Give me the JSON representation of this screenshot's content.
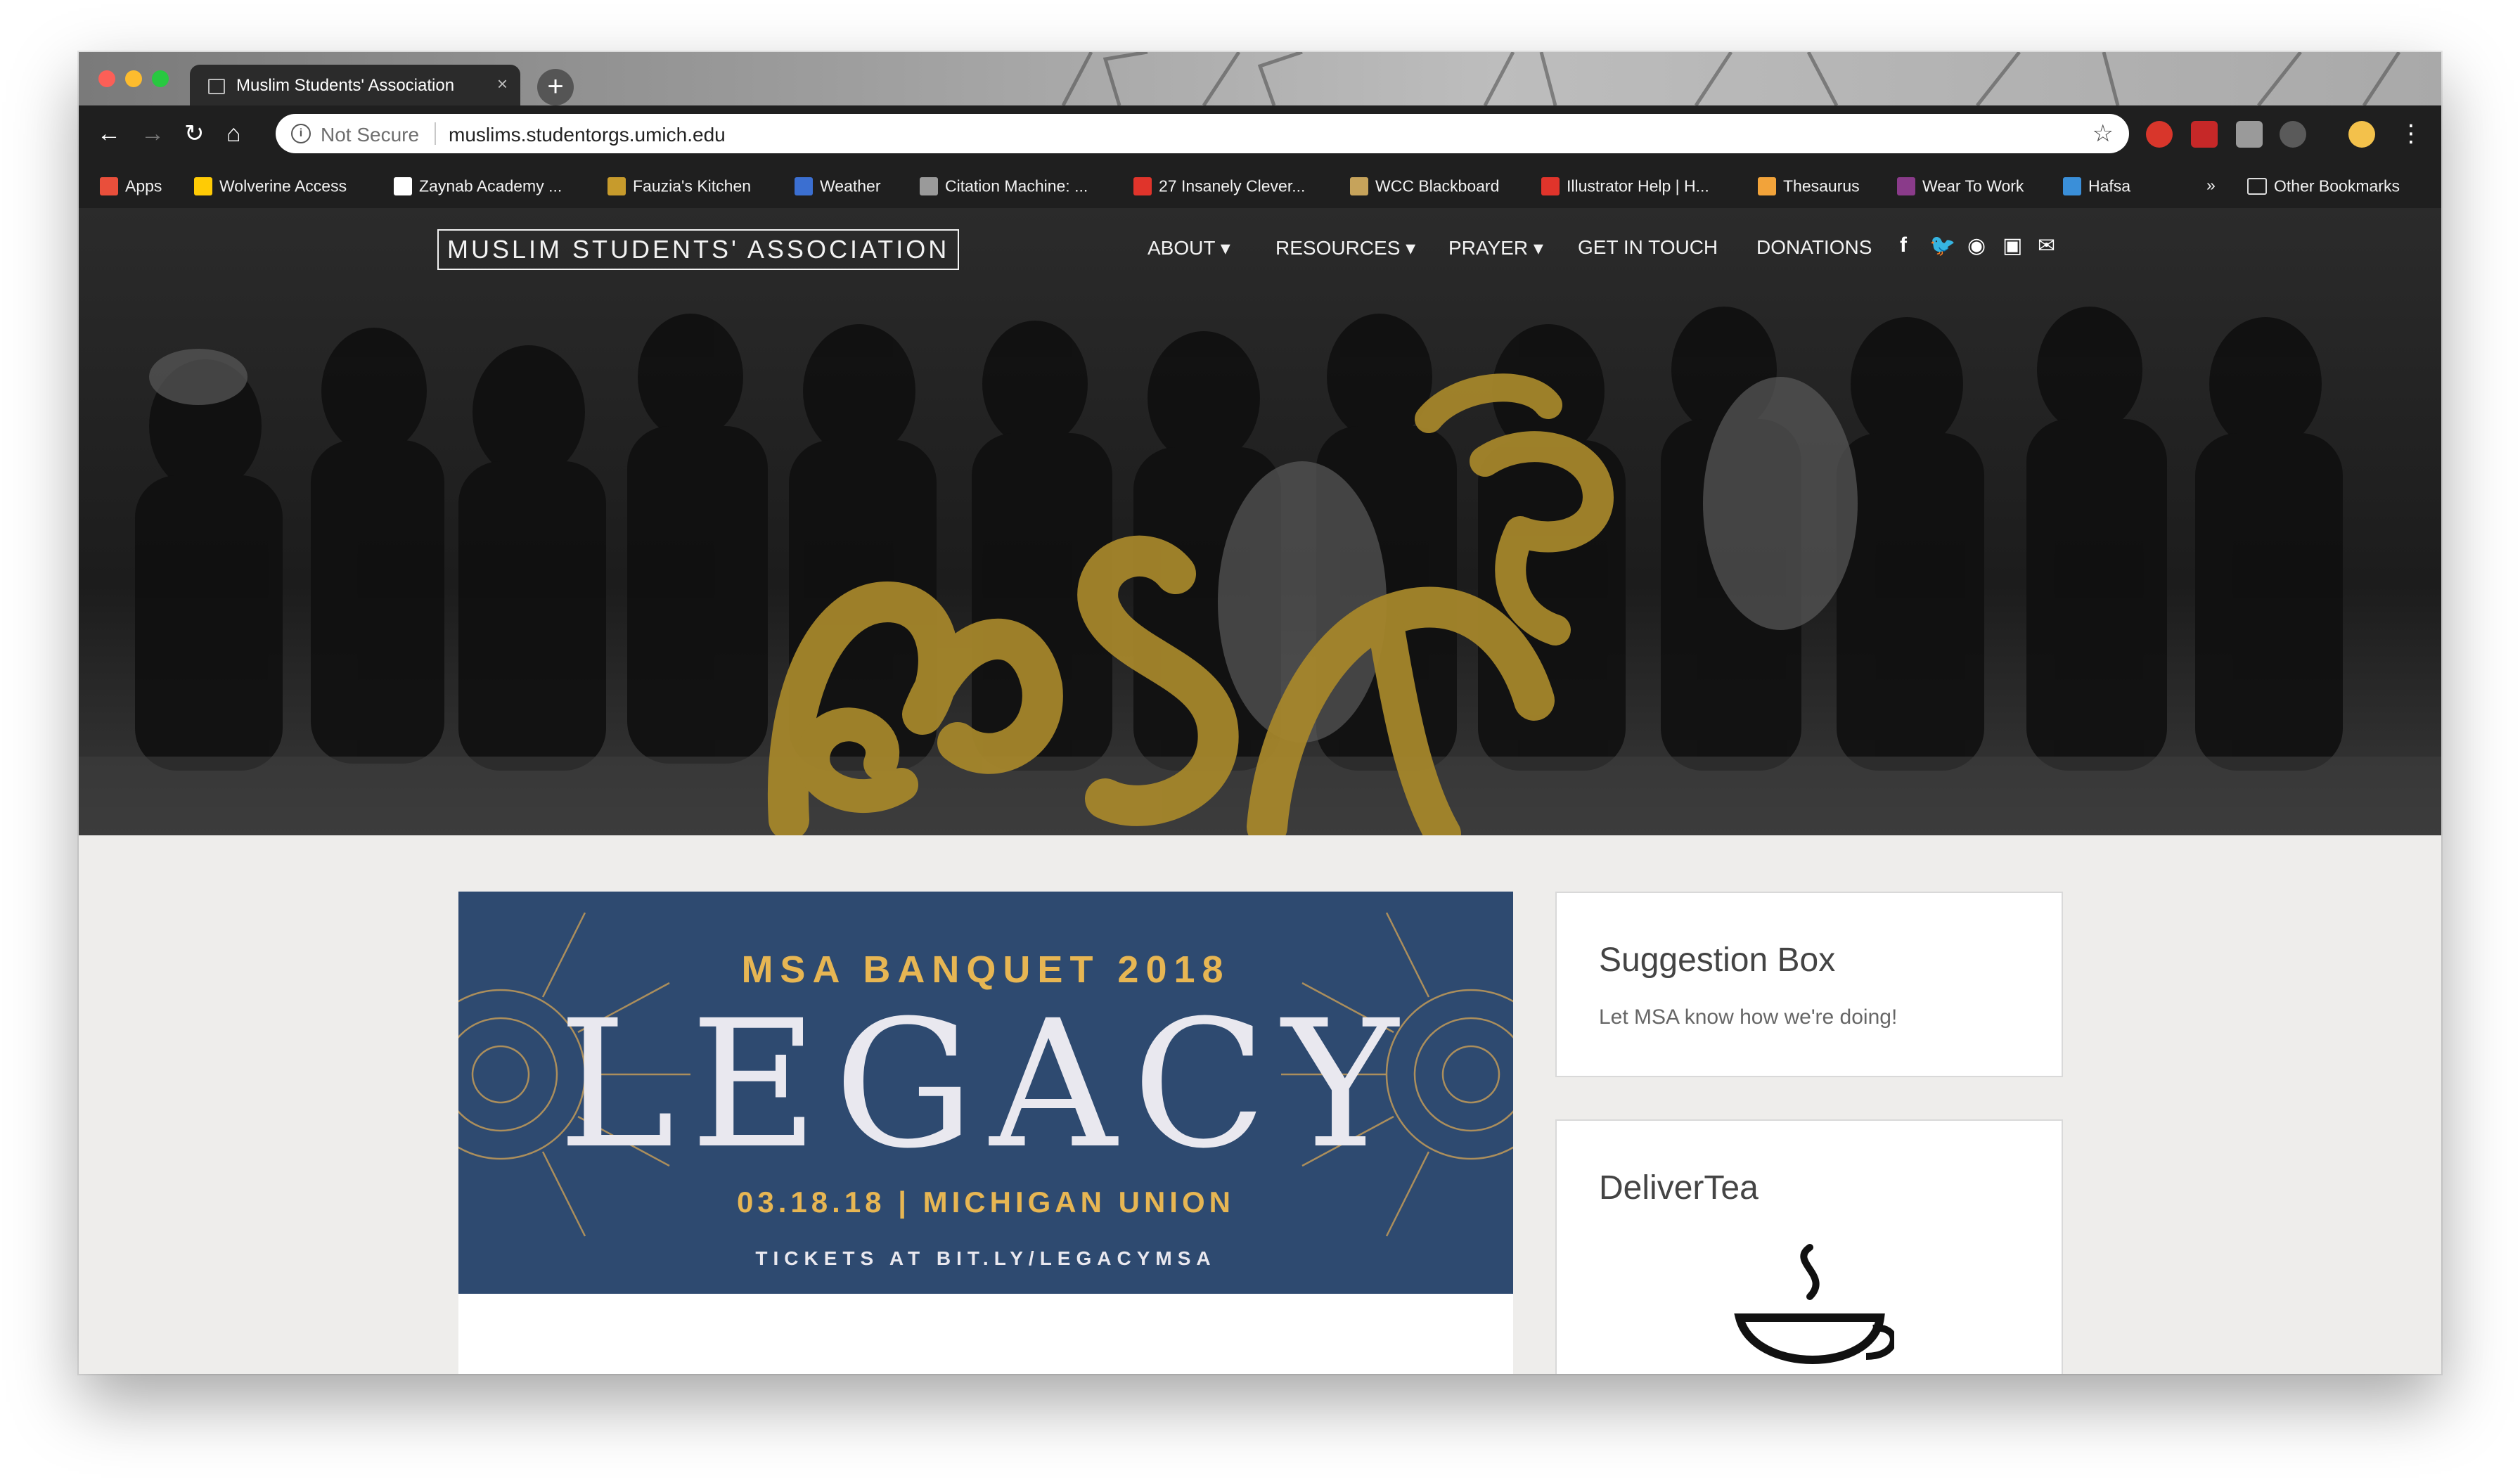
{
  "browser": {
    "tab_title": "Muslim Students' Association",
    "tab_close": "×",
    "new_tab": "+",
    "security_text": "Not Secure",
    "url": "muslims.studentorgs.umich.edu",
    "bookmarks": [
      {
        "label": "Apps",
        "color": "#e94f3b"
      },
      {
        "label": "Wolverine Access",
        "color": "#ffcb05"
      },
      {
        "label": "Zaynab Academy ...",
        "color": "#ffffff"
      },
      {
        "label": "Fauzia's Kitchen",
        "color": "#c79b2c"
      },
      {
        "label": "Weather",
        "color": "#3b6fd1"
      },
      {
        "label": "Citation Machine: ...",
        "color": "#9a9a9a"
      },
      {
        "label": "27 Insanely Clever...",
        "color": "#e0342b"
      },
      {
        "label": "WCC Blackboard",
        "color": "#c6a35b"
      },
      {
        "label": "Illustrator Help | H...",
        "color": "#e0342b"
      },
      {
        "label": "Thesaurus",
        "color": "#f2a33a"
      },
      {
        "label": "Wear To Work",
        "color": "#8a3b8a"
      },
      {
        "label": "Hafsa",
        "color": "#3a8fd9"
      }
    ],
    "overflow": "»",
    "other_bookmarks": "Other Bookmarks"
  },
  "site": {
    "brand": "MUSLIM STUDENTS' ASSOCIATION",
    "menu": [
      "ABOUT ▾",
      "RESOURCES ▾",
      "PRAYER ▾",
      "GET IN TOUCH",
      "DONATIONS"
    ],
    "social_icons": [
      "facebook-icon",
      "twitter-icon",
      "flickr-icon",
      "instagram-icon",
      "email-icon"
    ],
    "accent": "#a5862b"
  },
  "banner": {
    "kicker": "MSA BANQUET 2018",
    "title": "LEGACY",
    "date": "03.18.18 | MICHIGAN UNION",
    "tickets": "TICKETS AT BIT.LY/LEGACYMSA",
    "colors": {
      "bg": "#2e4a70",
      "gold": "#e7b653"
    }
  },
  "sidebar": {
    "suggestion": {
      "title": "Suggestion Box",
      "text": "Let MSA know how we're doing!"
    },
    "delivertea": {
      "title": "DeliverTea"
    }
  }
}
